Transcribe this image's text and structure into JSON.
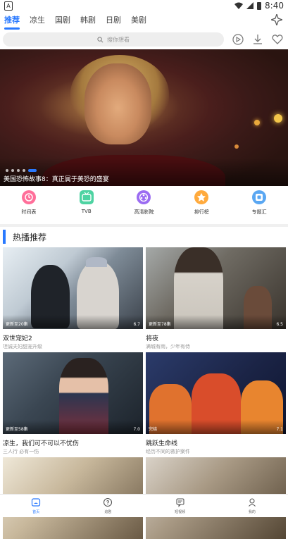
{
  "status_bar": {
    "time": "8:40",
    "left_icon": "A"
  },
  "tabs": [
    "推荐",
    "凉生",
    "国剧",
    "韩剧",
    "日剧",
    "美剧"
  ],
  "search": {
    "placeholder": "搜你想看"
  },
  "header_icons": [
    "history-icon",
    "download-icon",
    "heart-icon",
    "grid-icon"
  ],
  "banner": {
    "caption": "美国恐怖故事8：真正属于美恐的盛宴",
    "dots": 5,
    "active_dot": 5
  },
  "categories": [
    {
      "label": "时间表",
      "icon": "clock-icon",
      "color": "#ff6f9a"
    },
    {
      "label": "TVB",
      "icon": "tvb-icon",
      "color": "#4ed3a2"
    },
    {
      "label": "高清影院",
      "icon": "film-reel-icon",
      "color": "#9b6cf2"
    },
    {
      "label": "排行榜",
      "icon": "ranking-icon",
      "color": "#ffaa3d"
    },
    {
      "label": "专题汇",
      "icon": "topics-icon",
      "color": "#5aa7f2"
    }
  ],
  "section": {
    "title": "热播推荐"
  },
  "cards": [
    {
      "title": "双世宠妃2",
      "subtitle": "坦诚夫妇甜宠升级",
      "meta": "更新至20集",
      "score": "6.7"
    },
    {
      "title": "将夜",
      "subtitle": "满城有雨，少年有侍",
      "meta": "更新至78集",
      "score": "6.5"
    },
    {
      "title": "凉生，我们可不可以不忧伤",
      "subtitle": "三人行 必有一伤",
      "meta": "更新至58集",
      "score": "7.0"
    },
    {
      "title": "跳跃生命线",
      "subtitle": "经历不同的救护案件",
      "meta": "完结",
      "score": "7.1"
    },
    {
      "title": "",
      "subtitle": "",
      "meta": "",
      "score": ""
    },
    {
      "title": "",
      "subtitle": "",
      "meta": "",
      "score": ""
    }
  ],
  "bottom_nav": [
    {
      "label": "首页",
      "icon": "home-icon",
      "active": true
    },
    {
      "label": "追剧",
      "icon": "follow-icon",
      "active": false
    },
    {
      "label": "短视频",
      "icon": "short-video-icon",
      "active": false
    },
    {
      "label": "我的",
      "icon": "profile-icon",
      "active": false
    }
  ],
  "colors": {
    "accent": "#2979ff"
  }
}
